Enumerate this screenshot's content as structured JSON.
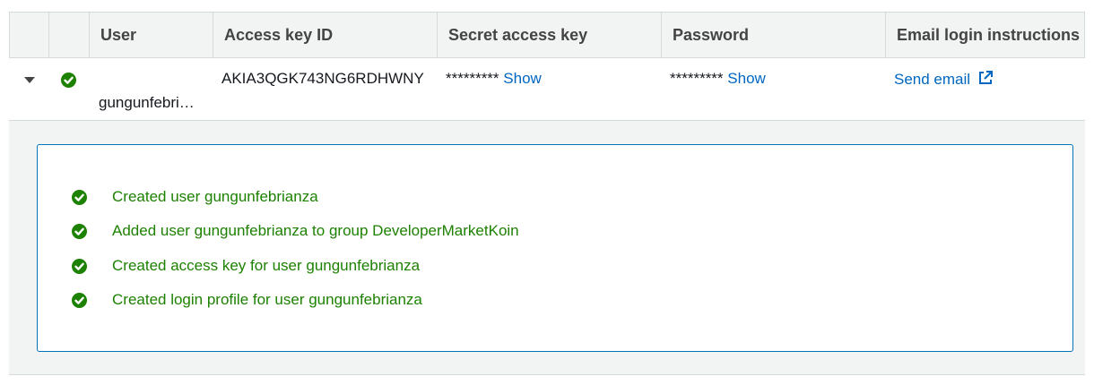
{
  "table": {
    "headers": [
      "User",
      "Access key ID",
      "Secret access key",
      "Password",
      "Email login instructions"
    ],
    "row": {
      "user": "gungunfebri…",
      "access_key_id": "AKIA3QGK743NG6RDHWNY",
      "secret_mask": "*********",
      "secret_show": "Show",
      "password_mask": "*********",
      "password_show": "Show",
      "email_link": "Send email",
      "expand_icon": "caret-down-icon",
      "status_icon": "success-check-icon",
      "external_icon": "external-link-icon"
    }
  },
  "messages": [
    "Created user gungunfebrianza",
    "Added user gungunfebrianza to group DeveloperMarketKoin",
    "Created access key for user gungunfebrianza",
    "Created login profile for user gungunfebrianza"
  ],
  "colors": {
    "success": "#1d8102",
    "link": "#0066c0",
    "box_border": "#0073bb",
    "header_bg": "#f2f3f3"
  }
}
